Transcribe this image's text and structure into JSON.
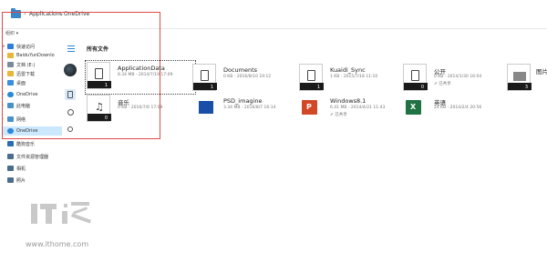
{
  "address": {
    "crumbs": [
      "Applications",
      "OneDrive"
    ]
  },
  "toolbar": {
    "organize": "组织 ▾"
  },
  "nav": {
    "items": [
      {
        "label": "快速访问",
        "icon": "star-icon"
      },
      {
        "label": "BaiduYunDownlo",
        "icon": "folder-icon"
      },
      {
        "label": "文档 (E:)",
        "icon": "drive-icon"
      },
      {
        "label": "迅雷下载",
        "icon": "folder-icon"
      },
      {
        "label": "桌面",
        "icon": "desktop-icon"
      },
      {
        "label": "OneDrive",
        "icon": "cloud-icon"
      },
      {
        "label": "此电脑",
        "icon": "computer-icon"
      },
      {
        "label": "网络",
        "icon": "network-icon"
      },
      {
        "label": "OneDrive",
        "icon": "cloud-icon"
      },
      {
        "label": "酷狗音乐",
        "icon": "music-icon"
      },
      {
        "label": "文件资源管理器",
        "icon": "folder-icon"
      },
      {
        "label": "相机",
        "icon": "folder-icon"
      },
      {
        "label": "照片",
        "icon": "folder-icon"
      }
    ]
  },
  "main": {
    "title": "所有文件",
    "files": [
      {
        "name": "ApplicationData",
        "meta": "8.34 MB - 2014/7/19 17:09",
        "meta2": "",
        "count": "1",
        "kind": "folder"
      },
      {
        "name": "Documents",
        "meta": "0 KB - 2016/8/10 19:12",
        "meta2": "",
        "count": "1",
        "kind": "folder"
      },
      {
        "name": "Kuaidi_Sync",
        "meta": "1 KB - 2015/7/18 11:10",
        "meta2": "",
        "count": "1",
        "kind": "folder"
      },
      {
        "name": "公开",
        "meta": "0 KB - 2014/1/30 16:04",
        "meta2": "⇗ 已共享",
        "count": "0",
        "kind": "folder"
      },
      {
        "name": "图片",
        "meta": "",
        "meta2": "",
        "count": "3",
        "kind": "img"
      },
      {
        "name": "音乐",
        "meta": "0 KB - 2016/7/6 17:09",
        "meta2": "",
        "count": "0",
        "kind": "music"
      },
      {
        "name": "PSD_imagine",
        "meta": "3.34 MB - 2016/8/7 16:14",
        "meta2": "",
        "count": "",
        "kind": "psd"
      },
      {
        "name": "Windows8.1",
        "meta": "6.41 MB - 2014/4/21 11:43",
        "meta2": "⇗ 已共享",
        "count": "",
        "kind": "ppt"
      },
      {
        "name": "英语",
        "meta": "24 KB - 2014/2/4 20:56",
        "meta2": "",
        "count": "",
        "kind": "xls"
      }
    ]
  },
  "watermark": {
    "logo": "IT之家",
    "url": "www.ithome.com"
  }
}
